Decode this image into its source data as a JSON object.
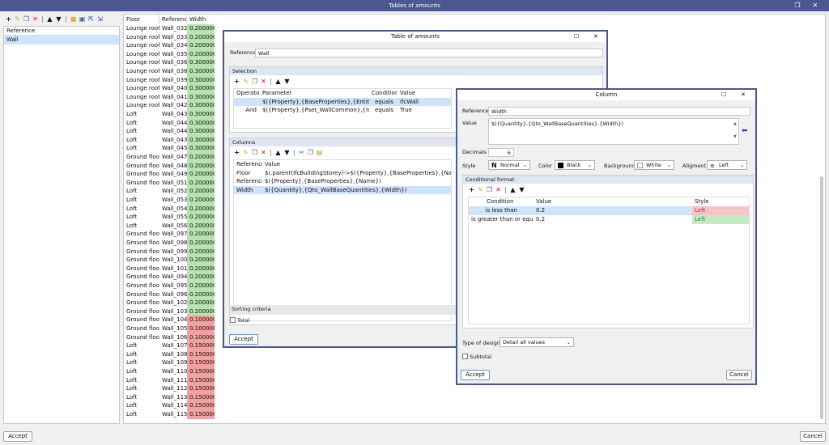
{
  "window": {
    "title": "Tables of amounts",
    "restore_glyph": "❐",
    "close_glyph": "✕"
  },
  "main_toolbar": {
    "icons": [
      "plus-icon",
      "pencil-icon",
      "copy-icon",
      "delete-icon",
      "up-arrow-icon",
      "down-arrow-icon",
      "open-folder-icon",
      "save-icon",
      "export-icon",
      "import-icon"
    ]
  },
  "left_list": {
    "header": "Reference",
    "items": [
      "Wall"
    ]
  },
  "table": {
    "headers": [
      "Floor",
      "Reference",
      "Width"
    ],
    "rows": [
      [
        "Lounge roof",
        "Wall_032",
        "0.200000",
        "green"
      ],
      [
        "Lounge roof",
        "Wall_033",
        "0.200000",
        "green"
      ],
      [
        "Lounge roof",
        "Wall_034",
        "0.200000",
        "green"
      ],
      [
        "Lounge roof",
        "Wall_035",
        "0.200000",
        "green"
      ],
      [
        "Lounge roof",
        "Wall_036",
        "0.300000",
        "green"
      ],
      [
        "Lounge roof",
        "Wall_038",
        "0.300000",
        "green"
      ],
      [
        "Lounge roof",
        "Wall_039",
        "0.300000",
        "green"
      ],
      [
        "Lounge roof",
        "Wall_040",
        "0.300000",
        "green"
      ],
      [
        "Lounge roof",
        "Wall_041",
        "0.300000",
        "green"
      ],
      [
        "Lounge roof",
        "Wall_042",
        "0.300000",
        "green"
      ],
      [
        "Loft",
        "Wall_043",
        "0.300000",
        "green"
      ],
      [
        "Loft",
        "Wall_044",
        "0.300000",
        "green"
      ],
      [
        "Loft",
        "Wall_044",
        "0.300000",
        "green"
      ],
      [
        "Loft",
        "Wall_043",
        "0.300000",
        "green"
      ],
      [
        "Loft",
        "Wall_045",
        "0.300000",
        "green"
      ],
      [
        "Ground floor",
        "Wall_047",
        "0.200000",
        "green"
      ],
      [
        "Ground floor",
        "Wall_048",
        "0.200000",
        "green"
      ],
      [
        "Ground floor",
        "Wall_049",
        "0.200000",
        "green"
      ],
      [
        "Ground floor",
        "Wall_051",
        "0.200000",
        "green"
      ],
      [
        "Loft",
        "Wall_052",
        "0.200000",
        "green"
      ],
      [
        "Loft",
        "Wall_053",
        "0.200000",
        "green"
      ],
      [
        "Loft",
        "Wall_054",
        "0.200000",
        "green"
      ],
      [
        "Loft",
        "Wall_055",
        "0.200000",
        "green"
      ],
      [
        "Loft",
        "Wall_056",
        "0.200000",
        "green"
      ],
      [
        "Ground floor",
        "Wall_097",
        "0.200000",
        "green"
      ],
      [
        "Ground floor",
        "Wall_098",
        "0.200000",
        "green"
      ],
      [
        "Ground floor",
        "Wall_099",
        "0.200000",
        "green"
      ],
      [
        "Ground floor",
        "Wall_100",
        "0.200000",
        "green"
      ],
      [
        "Ground floor",
        "Wall_101",
        "0.200000",
        "green"
      ],
      [
        "Ground floor",
        "Wall_094",
        "0.200000",
        "green"
      ],
      [
        "Ground floor",
        "Wall_095",
        "0.200000",
        "green"
      ],
      [
        "Ground floor",
        "Wall_096",
        "0.200000",
        "green"
      ],
      [
        "Ground floor",
        "Wall_102",
        "0.200000",
        "green"
      ],
      [
        "Ground floor",
        "Wall_103",
        "0.200000",
        "green"
      ],
      [
        "Ground floor",
        "Wall_104",
        "0.100000",
        "red"
      ],
      [
        "Ground floor",
        "Wall_105",
        "0.100000",
        "red"
      ],
      [
        "Ground floor",
        "Wall_106",
        "0.100000",
        "red"
      ],
      [
        "Loft",
        "Wall_107",
        "0.150000",
        "red"
      ],
      [
        "Loft",
        "Wall_108",
        "0.150000",
        "red"
      ],
      [
        "Loft",
        "Wall_109",
        "0.150000",
        "red"
      ],
      [
        "Loft",
        "Wall_110",
        "0.150000",
        "red"
      ],
      [
        "Loft",
        "Wall_111",
        "0.150000",
        "red"
      ],
      [
        "Loft",
        "Wall_112",
        "0.150000",
        "red"
      ],
      [
        "Loft",
        "Wall_113",
        "0.150000",
        "red"
      ],
      [
        "Loft",
        "Wall_114",
        "0.150000",
        "red"
      ],
      [
        "Loft",
        "Wall_115",
        "0.150000",
        "red"
      ]
    ]
  },
  "bottom": {
    "accept": "Accept",
    "cancel": "Cancel"
  },
  "dialog_amounts": {
    "title": "Table of amounts",
    "reference_label": "Reference",
    "reference_value": "Wall",
    "selection": {
      "title": "Selection",
      "headers": [
        "Operator",
        "Parameter",
        "Condition",
        "Value"
      ],
      "rows": [
        [
          "",
          "$({Property},{BaseProperties},{Entity})",
          "equals",
          "IfcWall"
        ],
        [
          "And",
          "$({Property},{Pset_WallCommon},{IsExternal})",
          "equals",
          "True"
        ]
      ]
    },
    "columns": {
      "title": "Columns",
      "headers": [
        "Reference",
        "Value"
      ],
      "rows": [
        [
          "Floor",
          "$(.parent(IfcBuildingStorey)->$({Property},{BaseProperties},{Name})"
        ],
        [
          "Reference",
          "$({Property},{BaseProperties},{Name})"
        ],
        [
          "Width",
          "$({Quantity},{Qto_WallBaseQuantities},{Width})"
        ]
      ]
    },
    "sorting_label": "Sorting criteria",
    "total_label": "Total",
    "accept": "Accept"
  },
  "dialog_column": {
    "title": "Column",
    "reference_label": "Reference",
    "reference_value": "Width",
    "value_label": "Value",
    "value_text": "$({Quantity},{Qto_WallBaseQuantities},{Width})",
    "decimals_label": "Decimals",
    "decimals_value": "6",
    "style_label": "Style",
    "style_value": "Normal",
    "color_label": "Color",
    "color_value": "Black",
    "background_label": "Background",
    "background_value": "White",
    "alignment_label": "Aligment",
    "alignment_value": "Left",
    "cond": {
      "title": "Conditional format",
      "headers": [
        "Condition",
        "Value",
        "Style"
      ],
      "rows": [
        [
          "is less than",
          "0.2",
          "Left",
          "#f4c4c8"
        ],
        [
          "is greater than or equal to",
          "0.2",
          "Left",
          "#c4ecc4"
        ]
      ]
    },
    "type_label": "Type of design",
    "type_value": "Detail all values",
    "subtotal_label": "Subtotal",
    "accept": "Accept",
    "cancel": "Cancel"
  }
}
